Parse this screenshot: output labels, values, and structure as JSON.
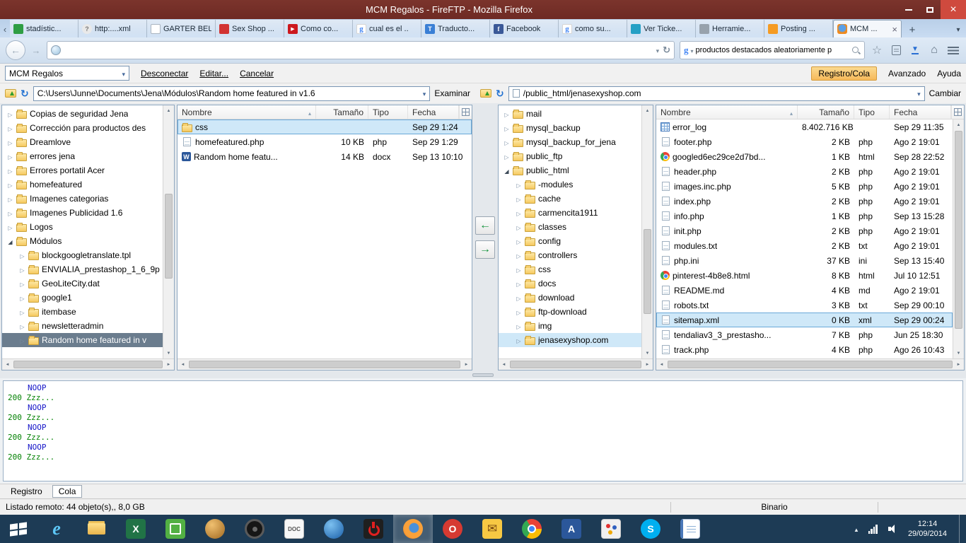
{
  "window": {
    "title": "MCM Regalos - FireFTP - Mozilla Firefox"
  },
  "browser": {
    "tabs": [
      {
        "label": "stadístic...",
        "icon": "chart"
      },
      {
        "label": "http:....xml",
        "icon": "question"
      },
      {
        "label": "GARTER BELT...",
        "icon": "page"
      },
      {
        "label": "Sex Shop ...",
        "icon": "sexshop"
      },
      {
        "label": "Como co...",
        "icon": "youtube"
      },
      {
        "label": "cual es el ..",
        "icon": "google"
      },
      {
        "label": "Traducto...",
        "icon": "translate"
      },
      {
        "label": "Facebook",
        "icon": "facebook"
      },
      {
        "label": "como su...",
        "icon": "google"
      },
      {
        "label": "Ver Ticke...",
        "icon": "ticket"
      },
      {
        "label": "Herramie...",
        "icon": "tools"
      },
      {
        "label": "Posting ...",
        "icon": "posting"
      },
      {
        "label": "MCM ...",
        "icon": "fireftp",
        "active": true
      }
    ],
    "url_value": "",
    "search_value": "productos destacados aleatoriamente p"
  },
  "fireftp": {
    "account": "MCM Regalos",
    "toolbar": {
      "disconnect": "Desconectar",
      "edit": "Editar...",
      "cancel": "Cancelar",
      "log_queue": "Registro/Cola",
      "advanced": "Avanzado",
      "help": "Ayuda"
    },
    "local": {
      "path": "C:\\Users\\Junne\\Documents\\Jena\\Módulos\\Random home featured in v1.6",
      "browse_label": "Examinar",
      "columns": [
        "Nombre",
        "Tamaño",
        "Tipo",
        "Fecha"
      ],
      "tree": [
        {
          "label": "Copias de seguridad Jena"
        },
        {
          "label": "Corrección para productos des"
        },
        {
          "label": "Dreamlove"
        },
        {
          "label": "errores jena"
        },
        {
          "label": "Errores portatil Acer"
        },
        {
          "label": "homefeatured"
        },
        {
          "label": "Imagenes categorias"
        },
        {
          "label": "Imagenes Publicidad 1.6"
        },
        {
          "label": "Logos"
        },
        {
          "label": "Módulos",
          "expanded": true
        },
        {
          "label": "blockgoogletranslate.tpl",
          "child": true
        },
        {
          "label": "ENVIALIA_prestashop_1_6_9p",
          "child": true
        },
        {
          "label": "GeoLiteCity.dat",
          "child": true
        },
        {
          "label": "google1",
          "child": true
        },
        {
          "label": "itembase",
          "child": true
        },
        {
          "label": "newsletteradmin",
          "child": true
        },
        {
          "label": "Random home featured in v",
          "child": true,
          "seldark": true
        }
      ],
      "files": [
        {
          "name": "css",
          "size": "",
          "type": "",
          "date": "Sep 29 1:24",
          "icon": "folder",
          "selected": true
        },
        {
          "name": "homefeatured.php",
          "size": "10 KB",
          "type": "php",
          "date": "Sep 29 1:29",
          "icon": "php"
        },
        {
          "name": "Random home featu...",
          "size": "14 KB",
          "type": "docx",
          "date": "Sep 13 10:10",
          "icon": "docx"
        }
      ]
    },
    "remote": {
      "path": "/public_html/jenasexyshop.com",
      "change_label": "Cambiar",
      "columns": [
        "Nombre",
        "Tamaño",
        "Tipo",
        "Fecha"
      ],
      "tree": [
        {
          "label": "mail"
        },
        {
          "label": "mysql_backup"
        },
        {
          "label": "mysql_backup_for_jena"
        },
        {
          "label": "public_ftp"
        },
        {
          "label": "public_html",
          "expanded": true
        },
        {
          "label": "-modules",
          "child": true
        },
        {
          "label": "cache",
          "child": true
        },
        {
          "label": "carmencita1911",
          "child": true
        },
        {
          "label": "classes",
          "child": true
        },
        {
          "label": "config",
          "child": true
        },
        {
          "label": "controllers",
          "child": true
        },
        {
          "label": "css",
          "child": true
        },
        {
          "label": "docs",
          "child": true
        },
        {
          "label": "download",
          "child": true
        },
        {
          "label": "ftp-download",
          "child": true
        },
        {
          "label": "img",
          "child": true
        },
        {
          "label": "jenasexyshop.com",
          "child": true,
          "sellight": true
        }
      ],
      "files": [
        {
          "name": "error_log",
          "size": "8.402.716 KB",
          "type": "",
          "date": "Sep 29 11:35",
          "icon": "log"
        },
        {
          "name": "footer.php",
          "size": "2 KB",
          "type": "php",
          "date": "Ago 2 19:01",
          "icon": "php"
        },
        {
          "name": "googled6ec29ce2d7bd...",
          "size": "1 KB",
          "type": "html",
          "date": "Sep 28 22:52",
          "icon": "html"
        },
        {
          "name": "header.php",
          "size": "2 KB",
          "type": "php",
          "date": "Ago 2 19:01",
          "icon": "php"
        },
        {
          "name": "images.inc.php",
          "size": "5 KB",
          "type": "php",
          "date": "Ago 2 19:01",
          "icon": "php"
        },
        {
          "name": "index.php",
          "size": "2 KB",
          "type": "php",
          "date": "Ago 2 19:01",
          "icon": "php"
        },
        {
          "name": "info.php",
          "size": "1 KB",
          "type": "php",
          "date": "Sep 13 15:28",
          "icon": "php"
        },
        {
          "name": "init.php",
          "size": "2 KB",
          "type": "php",
          "date": "Ago 2 19:01",
          "icon": "php"
        },
        {
          "name": "modules.txt",
          "size": "2 KB",
          "type": "txt",
          "date": "Ago 2 19:01",
          "icon": "txt"
        },
        {
          "name": "php.ini",
          "size": "37 KB",
          "type": "ini",
          "date": "Sep 13 15:40",
          "icon": "ini"
        },
        {
          "name": "pinterest-4b8e8.html",
          "size": "8 KB",
          "type": "html",
          "date": "Jul 10 12:51",
          "icon": "html"
        },
        {
          "name": "README.md",
          "size": "4 KB",
          "type": "md",
          "date": "Ago 2 19:01",
          "icon": "md"
        },
        {
          "name": "robots.txt",
          "size": "3 KB",
          "type": "txt",
          "date": "Sep 29 00:10",
          "icon": "txt"
        },
        {
          "name": "sitemap.xml",
          "size": "0 KB",
          "type": "xml",
          "date": "Sep 29 00:24",
          "icon": "xml",
          "selected": true
        },
        {
          "name": "tendaliav3_3_prestasho...",
          "size": "7 KB",
          "type": "php",
          "date": "Jun 25 18:30",
          "icon": "php"
        },
        {
          "name": "track.php",
          "size": "4 KB",
          "type": "php",
          "date": "Ago 26 10:43",
          "icon": "php"
        }
      ]
    },
    "log": [
      {
        "text": "NOOP",
        "cmd": true
      },
      {
        "text": "200 Zzz...",
        "cmd": false
      },
      {
        "text": "NOOP",
        "cmd": true
      },
      {
        "text": "200 Zzz...",
        "cmd": false
      },
      {
        "text": "NOOP",
        "cmd": true
      },
      {
        "text": "200 Zzz...",
        "cmd": false
      },
      {
        "text": "NOOP",
        "cmd": true
      },
      {
        "text": "200 Zzz...",
        "cmd": false
      }
    ],
    "bottom_tabs": {
      "log": "Registro",
      "queue": "Cola"
    },
    "status": {
      "listing": "Listado remoto: 44 objeto(s),, 8,0 GB",
      "mode": "Binario"
    }
  },
  "taskbar": {
    "apps": [
      {
        "name": "internet-explorer"
      },
      {
        "name": "file-explorer"
      },
      {
        "name": "excel"
      },
      {
        "name": "green-app"
      },
      {
        "name": "amber-app"
      },
      {
        "name": "audio-app"
      },
      {
        "name": "doc-app"
      },
      {
        "name": "media-app"
      },
      {
        "name": "power-app"
      },
      {
        "name": "firefox",
        "active": true
      },
      {
        "name": "opera"
      },
      {
        "name": "mail"
      },
      {
        "name": "chrome"
      },
      {
        "name": "word"
      },
      {
        "name": "paint"
      },
      {
        "name": "skype"
      },
      {
        "name": "notes"
      }
    ],
    "clock": {
      "time": "12:14",
      "date": "29/09/2014"
    }
  }
}
